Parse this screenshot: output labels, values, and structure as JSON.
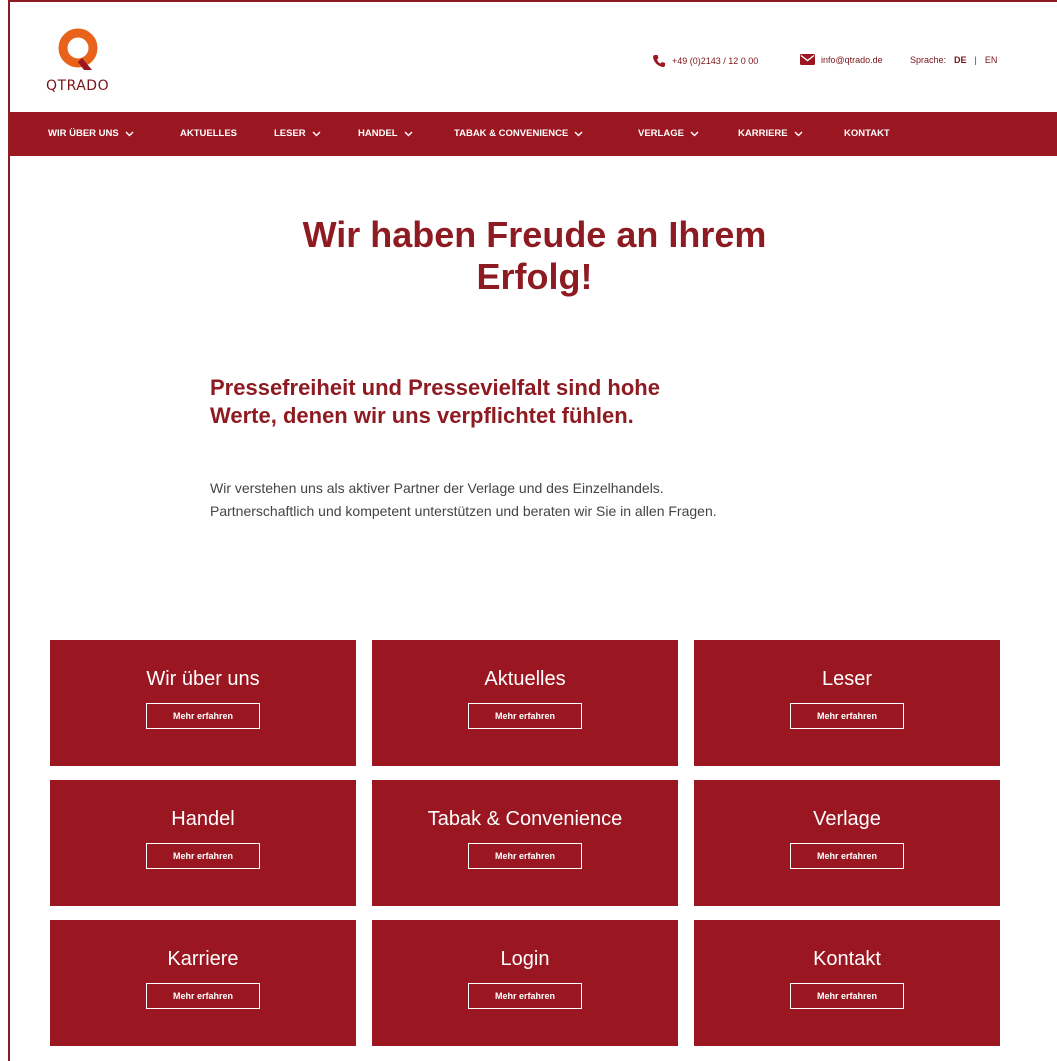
{
  "brand": {
    "name": "QTRADO",
    "color": "#9a1620",
    "logo_orange": "#e8621b"
  },
  "header": {
    "phone": "+49 (0)2143 / 12 0 00",
    "email": "info@qtrado.de",
    "language_label": "Sprache:",
    "languages": [
      "DE",
      "EN"
    ],
    "active_language": "DE"
  },
  "nav": {
    "items": [
      {
        "label": "WIR ÜBER UNS",
        "dropdown": true
      },
      {
        "label": "AKTUELLES",
        "dropdown": false
      },
      {
        "label": "LESER",
        "dropdown": true
      },
      {
        "label": "HANDEL",
        "dropdown": true
      },
      {
        "label": "TABAK & CONVENIENCE",
        "dropdown": true
      },
      {
        "label": "VERLAGE",
        "dropdown": true
      },
      {
        "label": "KARRIERE",
        "dropdown": true
      },
      {
        "label": "KONTAKT",
        "dropdown": false
      }
    ]
  },
  "hero": {
    "title_line1": "Wir haben Freude an Ihrem",
    "title_line2": "Erfolg!",
    "subhead_line1": "Pressefreiheit und Pressevielfalt sind hohe",
    "subhead_line2": "Werte, denen wir uns verpflichtet fühlen.",
    "intro_line1": "Wir verstehen uns als aktiver Partner der Verlage und des Einzelhandels.",
    "intro_line2": "Partnerschaftlich und kompetent unterstützen und beraten wir Sie in allen Fragen."
  },
  "tiles": [
    {
      "title": "Wir über uns",
      "button": "Mehr erfahren"
    },
    {
      "title": "Aktuelles",
      "button": "Mehr erfahren"
    },
    {
      "title": "Leser",
      "button": "Mehr erfahren"
    },
    {
      "title": "Handel",
      "button": "Mehr erfahren"
    },
    {
      "title": "Tabak & Convenience",
      "button": "Mehr erfahren"
    },
    {
      "title": "Verlage",
      "button": "Mehr erfahren"
    },
    {
      "title": "Karriere",
      "button": "Mehr erfahren"
    },
    {
      "title": "Login",
      "button": "Mehr erfahren"
    },
    {
      "title": "Kontakt",
      "button": "Mehr erfahren"
    }
  ]
}
